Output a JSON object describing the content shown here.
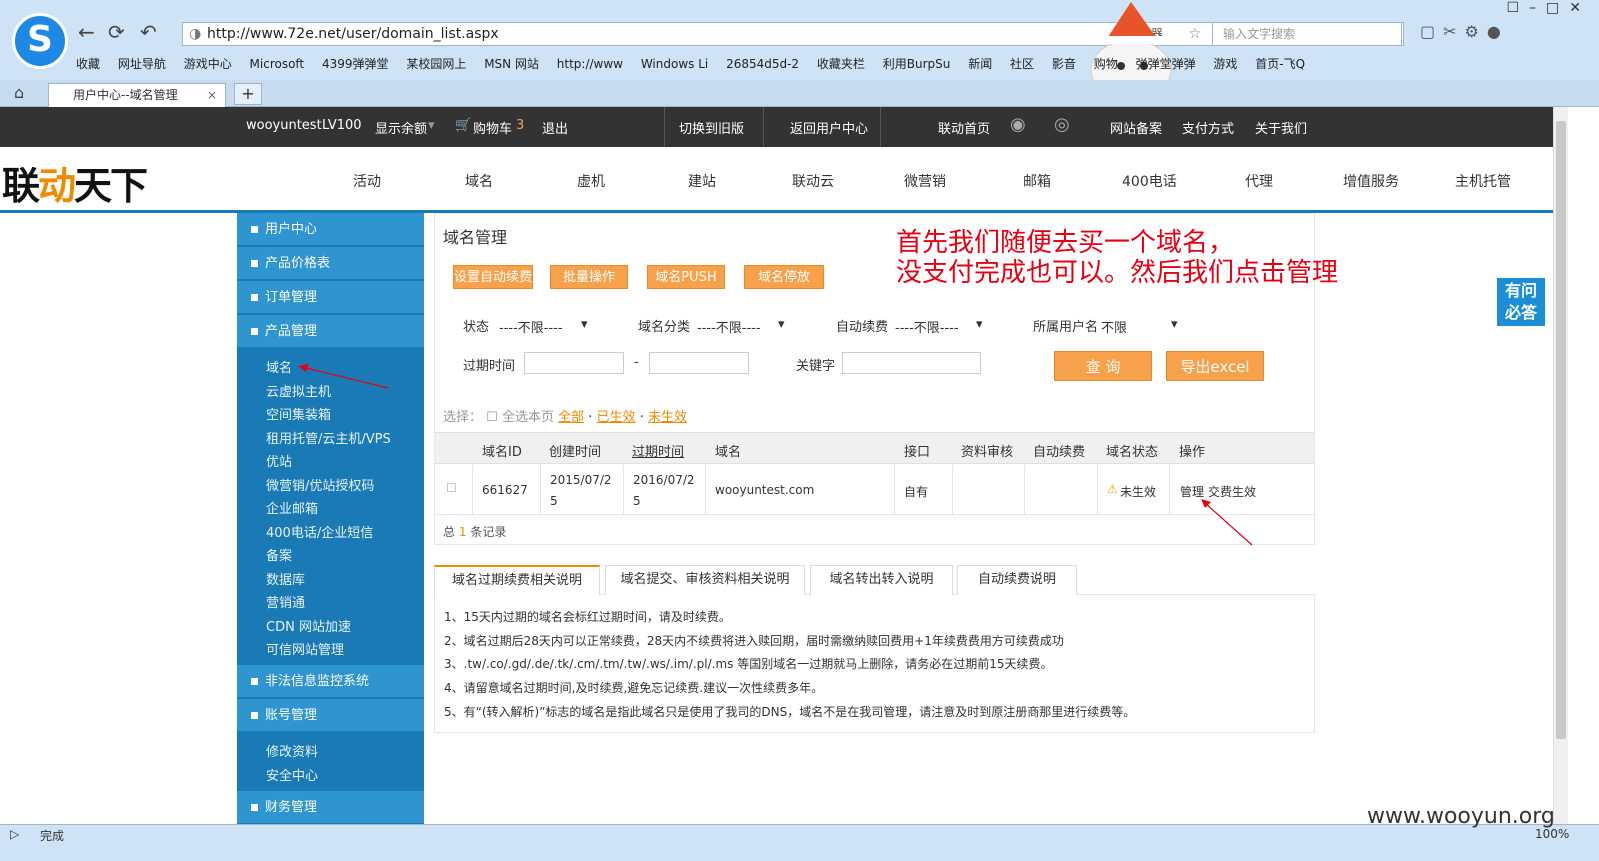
{
  "browser": {
    "url": "http://www.72e.net/user/domain_list.aspx",
    "accelerator": "加速器",
    "search_placeholder": "输入文字搜索",
    "tab_title": "用户中心--域名管理",
    "status": "完成",
    "zoom": "100%",
    "bookmarks": [
      "收藏",
      "网址导航",
      "游戏中心",
      "Microsoft",
      "4399弹弹堂",
      "某校园网上",
      "MSN 网站",
      "http://www",
      "Windows Li",
      "26854d5d-2",
      "收藏夹栏",
      "利用BurpSu",
      "新闻",
      "社区",
      "影音",
      "购物",
      "弹弹堂弹弹",
      "游戏",
      "首页-飞Q"
    ]
  },
  "topbar": {
    "user": "wooyuntest",
    "level": "LV100",
    "balance": "显示余额",
    "cart_label": "购物车",
    "cart_count": "3",
    "logout": "退出",
    "old_version": "切换到旧版",
    "back_center": "返回用户中心",
    "home": "联动首页",
    "record": "网站备案",
    "payment": "支付方式",
    "about": "关于我们"
  },
  "brand": {
    "part1": "联",
    "part2": "动",
    "part3": "天下"
  },
  "mainnav": [
    "活动",
    "域名",
    "虚机",
    "建站",
    "联动云",
    "微营销",
    "邮箱",
    "400电话",
    "代理",
    "增值服务",
    "主机托管"
  ],
  "sidebar": {
    "heads": [
      "用户中心",
      "产品价格表",
      "订单管理",
      "产品管理",
      "非法信息监控系统",
      "账号管理",
      "财务管理"
    ],
    "product_items": [
      "域名",
      "云虚拟主机",
      "空间集装箱",
      "租用托管/云主机/VPS",
      "优站",
      "微营销/优站授权码",
      "企业邮箱",
      "400电话/企业短信",
      "备案",
      "数据库",
      "营销通",
      "CDN 网站加速",
      "可信网站管理"
    ],
    "account_items": [
      "修改资料",
      "安全中心"
    ]
  },
  "content": {
    "title": "域名管理",
    "buttons": [
      "设置自动续费",
      "批量操作",
      "域名PUSH",
      "域名停放"
    ],
    "filters": {
      "status_label": "状态",
      "status_value": "----不限----",
      "category_label": "域名分类",
      "category_value": "----不限----",
      "autorenew_label": "自动续费",
      "autorenew_value": "----不限----",
      "owner_label": "所属用户名",
      "owner_value": "不限",
      "expire_label": "过期时间",
      "dash": "-",
      "keyword_label": "关键字"
    },
    "query_btn": "查 询",
    "export_btn": "导出excel",
    "select_label": "选择：",
    "select_page": "全选本页",
    "links": [
      "全部",
      "已生效",
      "未生效"
    ],
    "columns": [
      "域名ID",
      "创建时间",
      "过期时间",
      "域名",
      "接口",
      "资料审核",
      "自动续费",
      "域名状态",
      "操作"
    ],
    "row": {
      "id": "661627",
      "created_1": "2015/07/2",
      "created_2": "5",
      "expire_1": "2016/07/2",
      "expire_2": "5",
      "domain": "wooyuntest.com",
      "interface": "自有",
      "status": "未生效",
      "action_manage": "管理",
      "action_pay": "交费生效"
    },
    "total_prefix": "总",
    "total_count": "1",
    "total_suffix": "条记录"
  },
  "info_tabs": [
    "域名过期续费相关说明",
    "域名提交、审核资料相关说明",
    "域名转出转入说明",
    "自动续费说明"
  ],
  "notes": [
    "1、15天内过期的域名会标红过期时间，请及时续费。",
    "2、域名过期后28天内可以正常续费，28天内不续费将进入赎回期，届时需缴纳赎回费用+1年续费费用方可续费成功",
    "3、.tw/.co/.gd/.de/.tk/.cm/.tm/.tw/.ws/.im/.pl/.ms 等国别域名一过期就马上删除，请务必在过期前15天续费。",
    "4、请留意域名过期时间,及时续费,避免忘记续费.建议一次性续费多年。",
    "5、有“(转入解析)”标志的域名是指此域名只是使用了我司的DNS，域名不是在我司管理，请注意及时到原注册商那里进行续费等。"
  ],
  "annotation": {
    "line1": "首先我们随便去买一个域名，",
    "line2": "没支付完成也可以。然后我们点击管理"
  },
  "help": {
    "line1": "有问",
    "line2": "必答"
  },
  "watermark": "www.wooyun.org"
}
